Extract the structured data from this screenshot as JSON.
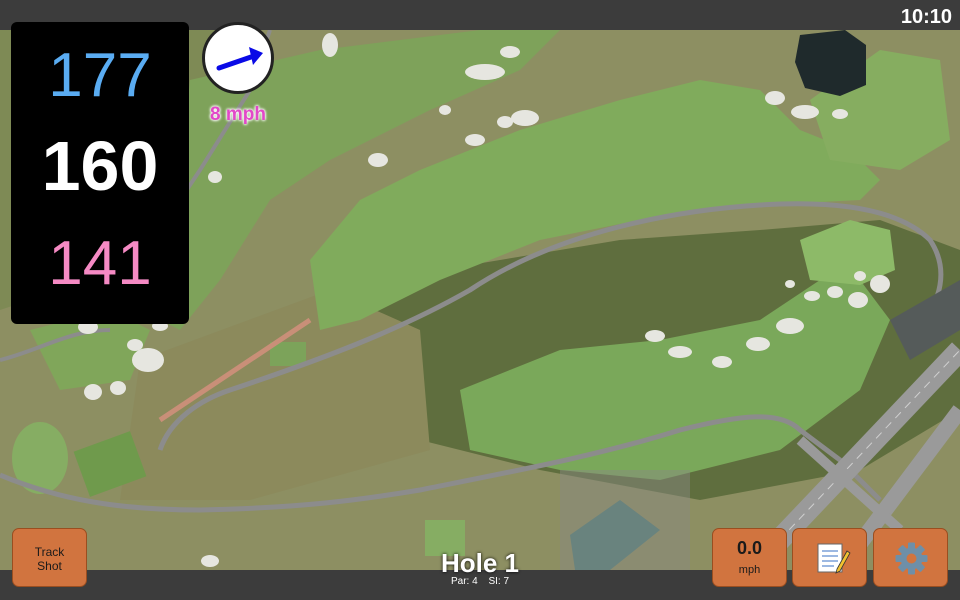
{
  "status_bar": {
    "time": "10:10"
  },
  "yardages": {
    "back": "177",
    "middle": "160",
    "front": "141"
  },
  "wind": {
    "speed": "8 mph",
    "direction_icon": "arrow-right-icon"
  },
  "hole": {
    "title": "Hole 1",
    "par": "Par: 4",
    "stroke_index": "SI: 7"
  },
  "buttons": {
    "track_shot_line1": "Track",
    "track_shot_line2": "Shot",
    "speed_value": "0.0",
    "speed_unit": "mph",
    "notes_icon": "notepad-icon",
    "settings_icon": "gear-icon"
  },
  "colors": {
    "back_yardage": "#5aacf2",
    "middle_yardage": "#ffffff",
    "front_yardage": "#f58ac4",
    "wind_text": "#e247c8",
    "button_bg": "#d1743f"
  }
}
